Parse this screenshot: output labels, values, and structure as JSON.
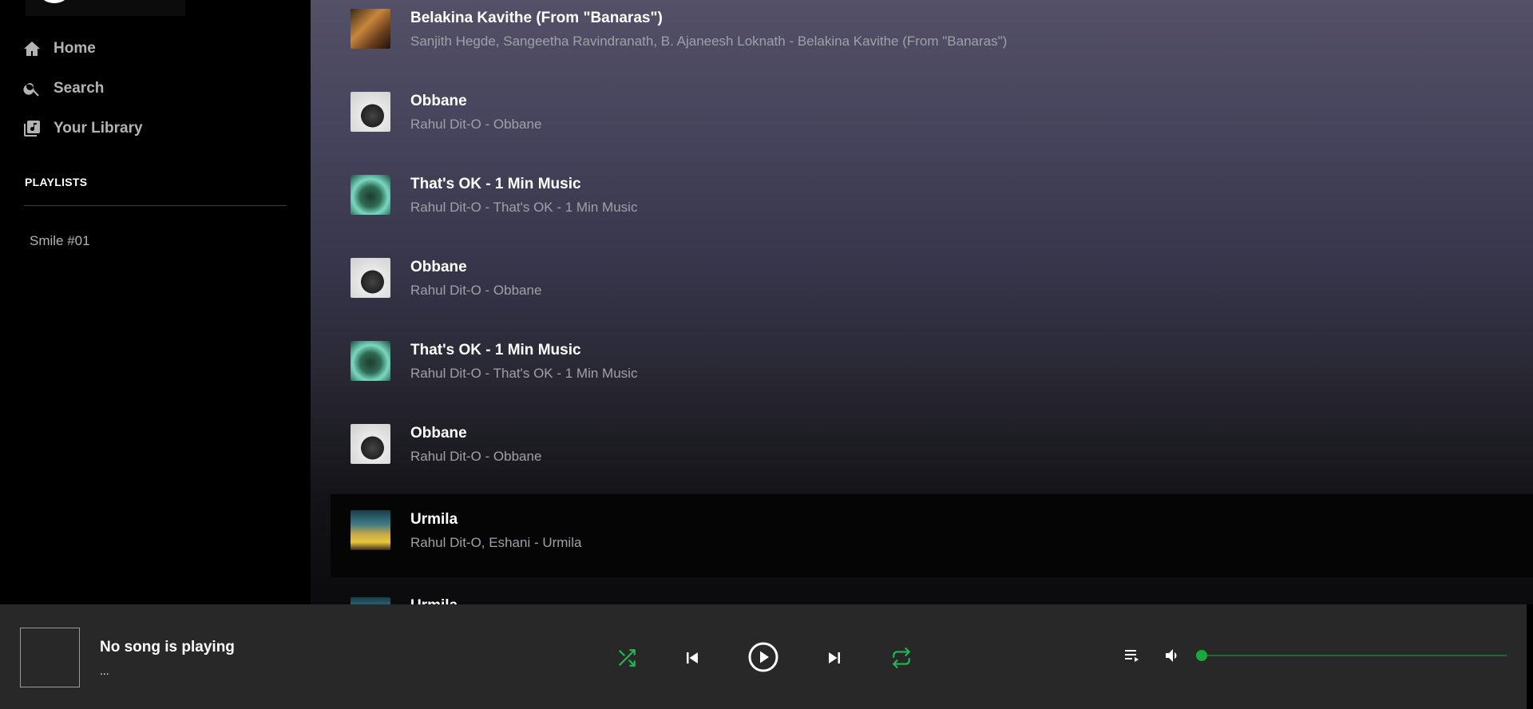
{
  "sidebar": {
    "nav": [
      {
        "label": "Home",
        "icon": "home-icon"
      },
      {
        "label": "Search",
        "icon": "search-icon"
      },
      {
        "label": "Your Library",
        "icon": "library-icon"
      }
    ],
    "playlists_heading": "PLAYLISTS",
    "playlists": [
      {
        "label": "Smile #01"
      }
    ]
  },
  "tracks": [
    {
      "title": "Belakina Kavithe (From \"Banaras\")",
      "subtitle": "Sanjith Hegde, Sangeetha Ravindranath, B. Ajaneesh Loknath - Belakina Kavithe (From \"Banaras\")"
    },
    {
      "title": "Obbane",
      "subtitle": "Rahul Dit-O - Obbane"
    },
    {
      "title": "That's OK - 1 Min Music",
      "subtitle": "Rahul Dit-O - That's OK - 1 Min Music"
    },
    {
      "title": "Obbane",
      "subtitle": "Rahul Dit-O - Obbane"
    },
    {
      "title": "That's OK - 1 Min Music",
      "subtitle": "Rahul Dit-O - That's OK - 1 Min Music"
    },
    {
      "title": "Obbane",
      "subtitle": "Rahul Dit-O - Obbane"
    },
    {
      "title": "Urmila",
      "subtitle": "Rahul Dit-O, Eshani - Urmila"
    },
    {
      "title": "Urmila",
      "subtitle": ""
    }
  ],
  "player": {
    "title": "No song is playing",
    "subtitle": "...",
    "volume_fraction": 0.0
  },
  "colors": {
    "accent_green": "#1db954",
    "player_bg": "#282828",
    "sidebar_bg": "#000000"
  }
}
